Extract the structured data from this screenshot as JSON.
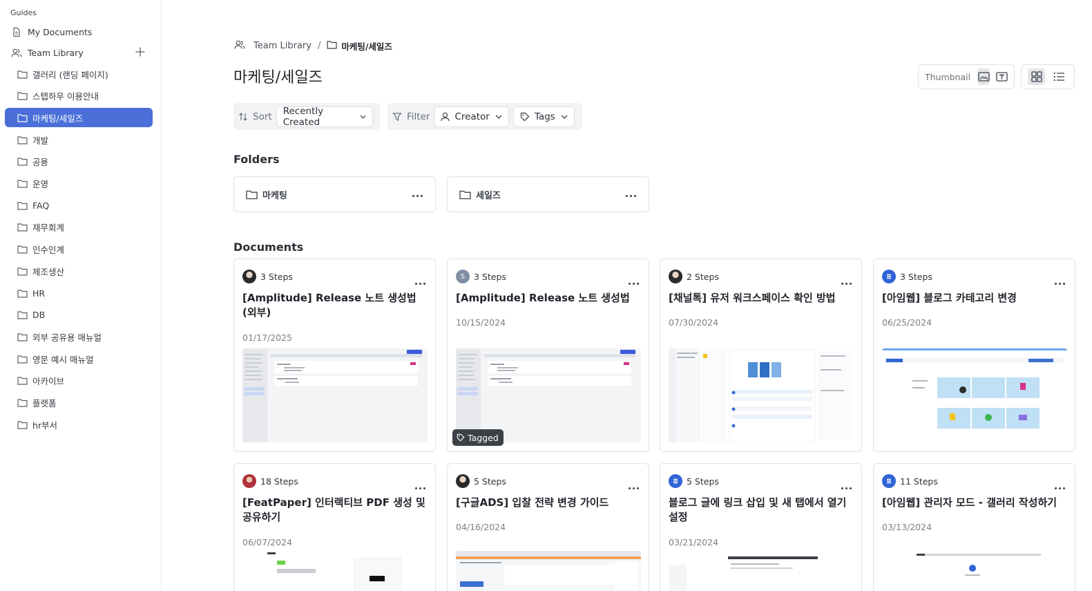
{
  "sidebar": {
    "header": "Guides",
    "my_documents": "My Documents",
    "team_library": "Team Library",
    "folders": [
      {
        "label": "갤러리 (랜딩 페이지)"
      },
      {
        "label": "스텝하우 이용안내"
      },
      {
        "label": "마케팅/세일즈",
        "active": true
      },
      {
        "label": "개발"
      },
      {
        "label": "공용"
      },
      {
        "label": "운영"
      },
      {
        "label": "FAQ"
      },
      {
        "label": "재무회계"
      },
      {
        "label": "인수인계"
      },
      {
        "label": "제조생산"
      },
      {
        "label": "HR"
      },
      {
        "label": "DB"
      },
      {
        "label": "외부 공유용 매뉴얼"
      },
      {
        "label": "영문 예시 매뉴얼"
      },
      {
        "label": "아카이브"
      },
      {
        "label": "플랫폼"
      },
      {
        "label": "hr부서"
      }
    ]
  },
  "breadcrumb": {
    "root": "Team Library",
    "separator": "/",
    "current": "마케팅/세일즈"
  },
  "page_title": "마케팅/세일즈",
  "view": {
    "thumbnail_label": "Thumbnail",
    "mode": "thumbnail-image",
    "layout": "grid"
  },
  "toolbar": {
    "sort_label": "Sort",
    "sort_value": "Recently Created",
    "filter_label": "Filter",
    "creator_label": "Creator",
    "tags_label": "Tags"
  },
  "folders_section": {
    "title": "Folders",
    "items": [
      {
        "label": "마케팅"
      },
      {
        "label": "세일즈"
      }
    ]
  },
  "documents_section": {
    "title": "Documents",
    "items": [
      {
        "steps": "3 Steps",
        "title": "[Amplitude] Release 노트 생성법 (외부)",
        "date": "01/17/2025",
        "avatar": "photo"
      },
      {
        "steps": "3 Steps",
        "title": "[Amplitude] Release 노트 생성법",
        "date": "10/15/2024",
        "avatar": "S",
        "tag": "Tagged"
      },
      {
        "steps": "2 Steps",
        "title": "[채널톡] 유저 워크스페이스 확인 방법",
        "date": "07/30/2024",
        "avatar": "photo"
      },
      {
        "steps": "3 Steps",
        "title": "[아임웹] 블로그 카테고리 변경",
        "date": "06/25/2024",
        "avatar": "logo"
      },
      {
        "steps": "18 Steps",
        "title": "[FeatPaper] 인터랙티브 PDF 생성 및 공유하기",
        "date": "06/07/2024",
        "avatar": "photo-red"
      },
      {
        "steps": "5 Steps",
        "title": "[구글ADS] 입찰 전략 변경 가이드",
        "date": "04/16/2024",
        "avatar": "photo"
      },
      {
        "steps": "5 Steps",
        "title": "블로그 글에 링크 삽입 및 새 탭에서 열기 설정",
        "date": "03/21/2024",
        "avatar": "logo"
      },
      {
        "steps": "11 Steps",
        "title": "[아임웹] 관리자 모드 - 갤러리 작성하기",
        "date": "03/13/2024",
        "avatar": "logo"
      }
    ]
  },
  "colors": {
    "accent": "#4a6fd8",
    "tag_bg": "#3c4047",
    "toolbar_bg": "#f2f3f5"
  }
}
